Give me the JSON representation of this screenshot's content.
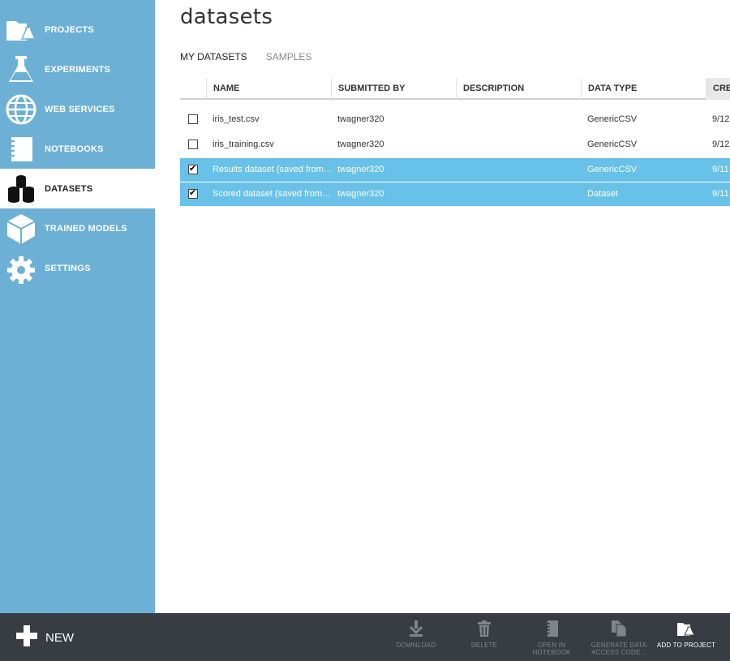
{
  "sidebar": {
    "items": [
      {
        "label": "PROJECTS",
        "icon": "projects-folder-icon"
      },
      {
        "label": "EXPERIMENTS",
        "icon": "flask-icon"
      },
      {
        "label": "WEB SERVICES",
        "icon": "globe-icon"
      },
      {
        "label": "NOTEBOOKS",
        "icon": "notebook-icon"
      },
      {
        "label": "DATASETS",
        "icon": "datasets-icon",
        "active": true
      },
      {
        "label": "TRAINED MODELS",
        "icon": "cube-icon"
      },
      {
        "label": "SETTINGS",
        "icon": "gear-icon"
      }
    ]
  },
  "main": {
    "title": "datasets",
    "tabs": [
      {
        "label": "MY DATASETS",
        "active": true
      },
      {
        "label": "SAMPLES",
        "active": false
      }
    ],
    "table": {
      "columns": [
        "NAME",
        "SUBMITTED BY",
        "DESCRIPTION",
        "DATA TYPE",
        "CRE"
      ],
      "rows": [
        {
          "checked": false,
          "name": "iris_test.csv",
          "submitted_by": "twagner320",
          "description": "",
          "data_type": "GenericCSV",
          "created": "9/12"
        },
        {
          "checked": false,
          "name": "iris_training.csv",
          "submitted_by": "twagner320",
          "description": "",
          "data_type": "GenericCSV",
          "created": "9/12"
        },
        {
          "checked": true,
          "name": "Results dataset (saved from…",
          "submitted_by": "twagner320",
          "description": "",
          "data_type": "GenericCSV",
          "created": "9/11"
        },
        {
          "checked": true,
          "name": "Scored dataset (saved from…",
          "submitted_by": "twagner320",
          "description": "",
          "data_type": "Dataset",
          "created": "9/11"
        }
      ]
    }
  },
  "bottombar": {
    "new_label": "NEW",
    "actions": [
      {
        "line1": "DOWNLOAD",
        "line2": "",
        "icon": "download-icon",
        "enabled": false
      },
      {
        "line1": "DELETE",
        "line2": "",
        "icon": "trash-icon",
        "enabled": false
      },
      {
        "line1": "OPEN IN",
        "line2": "NOTEBOOK",
        "icon": "notebook-icon",
        "enabled": false
      },
      {
        "line1": "GENERATE DATA",
        "line2": "ACCESS CODE...",
        "icon": "copy-icon",
        "enabled": false
      },
      {
        "line1": "ADD TO PROJECT",
        "line2": "",
        "icon": "add-to-project-icon",
        "enabled": true
      }
    ]
  },
  "colors": {
    "sidebar": "#6cb0d5",
    "selected_row": "#68c1e8",
    "bottom_bar": "#383d44"
  }
}
